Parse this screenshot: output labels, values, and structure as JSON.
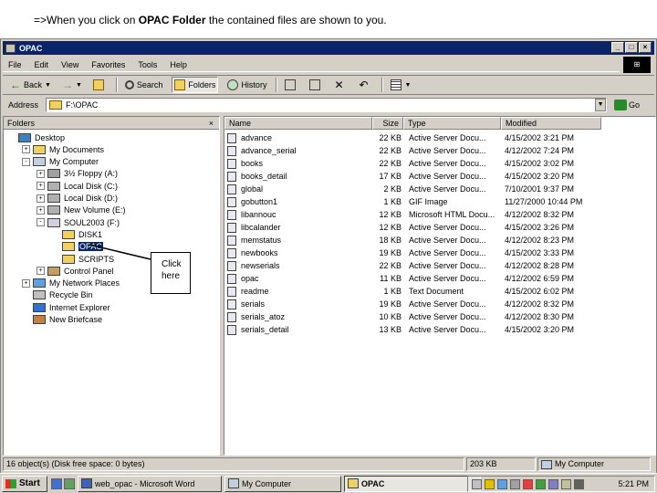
{
  "caption": {
    "prefix": "=>When you click on ",
    "bold": "OPAC Folder",
    "suffix": " the contained files are shown to you."
  },
  "window": {
    "title": "OPAC"
  },
  "menu": [
    "File",
    "Edit",
    "View",
    "Favorites",
    "Tools",
    "Help"
  ],
  "toolbar": {
    "back": "Back",
    "search": "Search",
    "folders": "Folders",
    "history": "History"
  },
  "address": {
    "label": "Address",
    "value": "F:\\OPAC",
    "go": "Go"
  },
  "folders_pane": {
    "title": "Folders",
    "close": "×",
    "tree": [
      {
        "label": "Desktop",
        "level": 0,
        "expander": "",
        "icon": "desktop-icon"
      },
      {
        "label": "My Documents",
        "level": 1,
        "expander": "+",
        "icon": "folder-icon"
      },
      {
        "label": "My Computer",
        "level": 1,
        "expander": "-",
        "icon": "computer-icon"
      },
      {
        "label": "3½ Floppy (A:)",
        "level": 2,
        "expander": "+",
        "icon": "floppy-icon"
      },
      {
        "label": "Local Disk (C:)",
        "level": 2,
        "expander": "+",
        "icon": "drive-icon"
      },
      {
        "label": "Local Disk (D:)",
        "level": 2,
        "expander": "+",
        "icon": "drive-icon"
      },
      {
        "label": "New Volume (E:)",
        "level": 2,
        "expander": "+",
        "icon": "drive-icon"
      },
      {
        "label": "SOUL2003 (F:)",
        "level": 2,
        "expander": "-",
        "icon": "cd-icon"
      },
      {
        "label": "DISK1",
        "level": 3,
        "expander": "",
        "icon": "folder-icon"
      },
      {
        "label": "OPAC",
        "level": 3,
        "expander": "",
        "icon": "folder-icon",
        "selected": true
      },
      {
        "label": "SCRIPTS",
        "level": 3,
        "expander": "",
        "icon": "folder-icon"
      },
      {
        "label": "Control Panel",
        "level": 2,
        "expander": "+",
        "icon": "control-panel-icon"
      },
      {
        "label": "My Network Places",
        "level": 1,
        "expander": "+",
        "icon": "network-icon"
      },
      {
        "label": "Recycle Bin",
        "level": 1,
        "expander": "",
        "icon": "recycle-bin-icon"
      },
      {
        "label": "Internet Explorer",
        "level": 1,
        "expander": "",
        "icon": "ie-icon"
      },
      {
        "label": "New Briefcase",
        "level": 1,
        "expander": "",
        "icon": "briefcase-icon"
      }
    ]
  },
  "columns": {
    "name": "Name",
    "size": "Size",
    "type": "Type",
    "modified": "Modified"
  },
  "files": [
    {
      "name": "advance",
      "size": "22 KB",
      "type": "Active Server Docu...",
      "modified": "4/15/2002 3:21 PM"
    },
    {
      "name": "advance_serial",
      "size": "22 KB",
      "type": "Active Server Docu...",
      "modified": "4/12/2002 7:24 PM"
    },
    {
      "name": "books",
      "size": "22 KB",
      "type": "Active Server Docu...",
      "modified": "4/15/2002 3:02 PM"
    },
    {
      "name": "books_detail",
      "size": "17 KB",
      "type": "Active Server Docu...",
      "modified": "4/15/2002 3:20 PM"
    },
    {
      "name": "global",
      "size": "2 KB",
      "type": "Active Server Docu...",
      "modified": "7/10/2001 9:37 PM"
    },
    {
      "name": "gobutton1",
      "size": "1 KB",
      "type": "GIF Image",
      "modified": "11/27/2000 10:44 PM"
    },
    {
      "name": "libannouc",
      "size": "12 KB",
      "type": "Microsoft HTML Docu...",
      "modified": "4/12/2002 8:32 PM"
    },
    {
      "name": "libcalander",
      "size": "12 KB",
      "type": "Active Server Docu...",
      "modified": "4/15/2002 3:26 PM"
    },
    {
      "name": "memstatus",
      "size": "18 KB",
      "type": "Active Server Docu...",
      "modified": "4/12/2002 8:23 PM"
    },
    {
      "name": "newbooks",
      "size": "19 KB",
      "type": "Active Server Docu...",
      "modified": "4/15/2002 3:33 PM"
    },
    {
      "name": "newserials",
      "size": "22 KB",
      "type": "Active Server Docu...",
      "modified": "4/12/2002 8:28 PM"
    },
    {
      "name": "opac",
      "size": "11 KB",
      "type": "Active Server Docu...",
      "modified": "4/12/2002 6:59 PM"
    },
    {
      "name": "readme",
      "size": "1 KB",
      "type": "Text Document",
      "modified": "4/15/2002 6:02 PM"
    },
    {
      "name": "serials",
      "size": "19 KB",
      "type": "Active Server Docu...",
      "modified": "4/12/2002 8:32 PM"
    },
    {
      "name": "serials_atoz",
      "size": "10 KB",
      "type": "Active Server Docu...",
      "modified": "4/12/2002 8:30 PM"
    },
    {
      "name": "serials_detail",
      "size": "13 KB",
      "type": "Active Server Docu...",
      "modified": "4/15/2002 3:20 PM"
    }
  ],
  "status": {
    "objects": "16 object(s) (Disk free space: 0 bytes)",
    "size": "203 KB",
    "location": "My Computer"
  },
  "taskbar": {
    "start": "Start",
    "tasks": [
      {
        "label": "web_opac - Microsoft Word",
        "active": false
      },
      {
        "label": "My Computer",
        "active": false
      },
      {
        "label": "OPAC",
        "active": true
      }
    ],
    "clock": "5:21 PM"
  },
  "callout": {
    "text": "Click here"
  },
  "colors": {
    "selection": "#0a246a",
    "face": "#d4d0c8",
    "folder": "#f0d060"
  }
}
